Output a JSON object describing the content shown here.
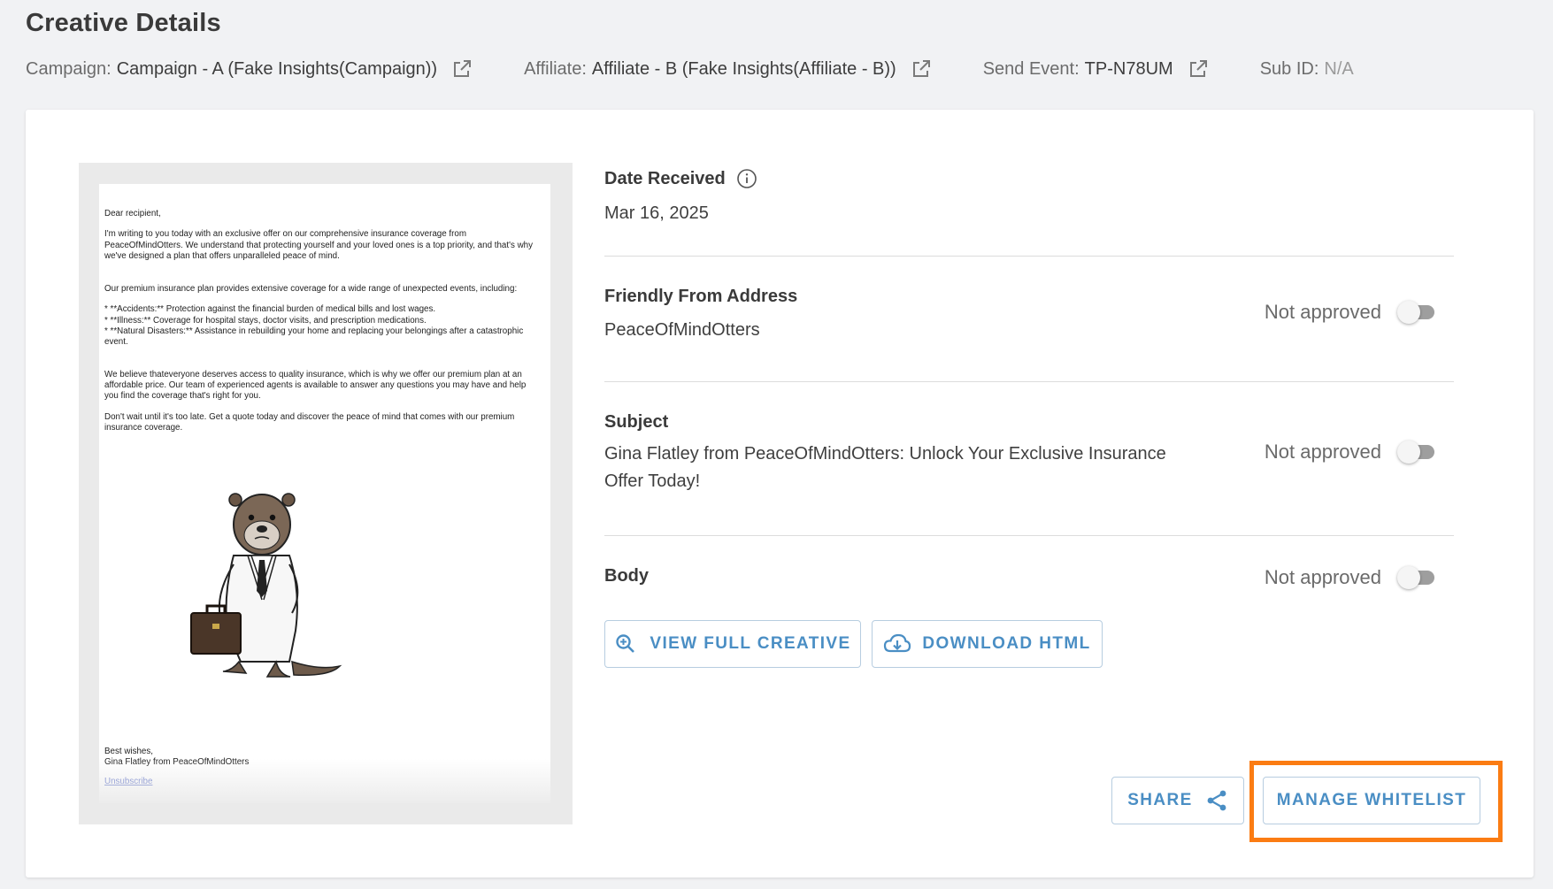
{
  "page": {
    "title": "Creative Details"
  },
  "meta": {
    "campaign": {
      "label": "Campaign:",
      "value": "Campaign - A (Fake Insights(Campaign))",
      "icon": "external-link-icon"
    },
    "affiliate": {
      "label": "Affiliate:",
      "value": "Affiliate - B (Fake Insights(Affiliate - B))",
      "icon": "external-link-icon"
    },
    "send_event": {
      "label": "Send Event:",
      "value": "TP-N78UM",
      "icon": "external-link-icon"
    },
    "sub_id": {
      "label": "Sub ID:",
      "value": "N/A"
    }
  },
  "preview": {
    "greeting": "Dear recipient,",
    "para1": "I'm writing to you today with an exclusive offer on our comprehensive insurance coverage from PeaceOfMindOtters. We understand that protecting yourself and your loved ones is a top priority, and that's why we've designed a plan that offers unparalleled peace of mind.",
    "para2": "Our premium insurance plan provides extensive coverage for a wide range of unexpected events, including:",
    "bullets": [
      "* **Accidents:** Protection against the financial burden of medical bills and lost wages.",
      "* **Illness:** Coverage for hospital stays, doctor visits, and prescription medications.",
      "* **Natural Disasters:** Assistance in rebuilding your home and replacing your belongings after a catastrophic event."
    ],
    "para3": "We believe thateveryone deserves access to quality insurance, which is why we offer our premium plan at an affordable price. Our team of experienced agents is available to answer any questions you may have and help you find the coverage that's right for you.",
    "para4": "Don't wait until it's too late. Get a quote today and discover the peace of mind that comes with our premium insurance coverage.",
    "closing": "Best wishes,",
    "signature": "Gina Flatley from PeaceOfMindOtters",
    "unsubscribe": "Unsubscribe"
  },
  "details": {
    "date_received": {
      "label": "Date Received",
      "value": "Mar 16, 2025",
      "icon": "info-icon"
    },
    "friendly_from": {
      "label": "Friendly From Address",
      "value": "PeaceOfMindOtters",
      "status": "Not approved",
      "approved": false
    },
    "subject": {
      "label": "Subject",
      "value": "Gina Flatley from PeaceOfMindOtters: Unlock Your Exclusive Insurance Offer Today!",
      "status": "Not approved",
      "approved": false
    },
    "body": {
      "label": "Body",
      "status": "Not approved",
      "approved": false
    }
  },
  "buttons": {
    "view_full_creative": "VIEW FULL CREATIVE",
    "download_html": "DOWNLOAD HTML",
    "share": "SHARE",
    "manage_whitelist": "MANAGE WHITELIST"
  },
  "colors": {
    "accent": "#4a8ec4",
    "highlight": "#fb7c13",
    "background": "#f1f2f4"
  }
}
